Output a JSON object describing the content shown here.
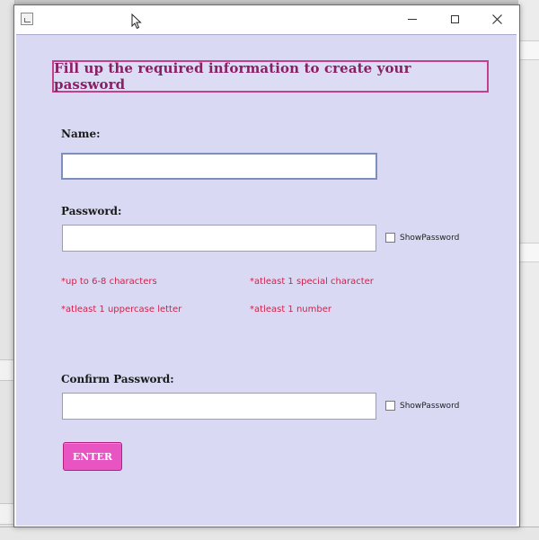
{
  "window": {
    "title": ""
  },
  "header": {
    "banner_text": "Fill up the required information to create your password"
  },
  "form": {
    "name_label": "Name:",
    "name_value": "",
    "password_label": "Password:",
    "password_value": "",
    "show_password_label": "ShowPassword",
    "confirm_label": "Confirm Password:",
    "confirm_value": "",
    "confirm_show_password_label": "ShowPassword",
    "enter_label": "ENTER"
  },
  "requirements": [
    "*up to 6-8 characters",
    "*atleast 1 special character",
    "*atleast 1 uppercase letter",
    "*atleast 1 number"
  ],
  "colors": {
    "background": "#d9d9f3",
    "banner_border": "#c2408c",
    "banner_text": "#8b1f64",
    "hint_text": "#d4204a",
    "button": "#e854c2"
  }
}
